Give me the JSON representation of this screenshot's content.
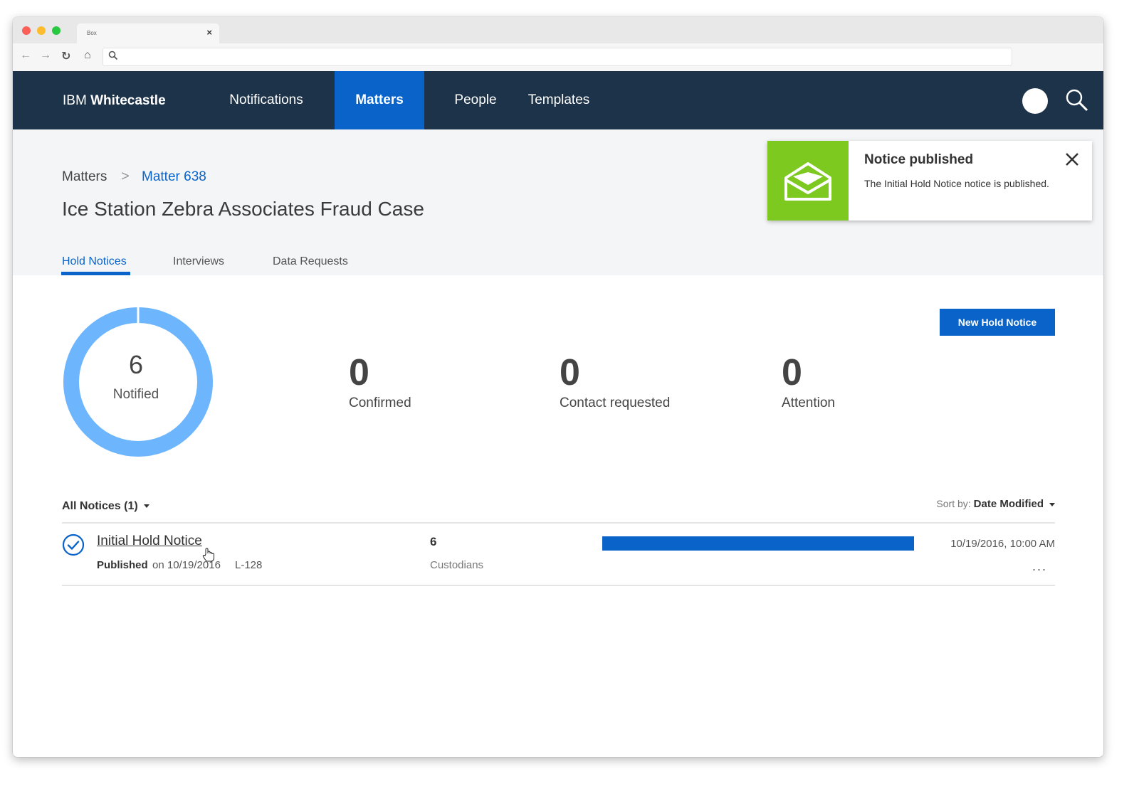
{
  "browser": {
    "tab_title": "Box",
    "tab_close": "×",
    "back": "←",
    "forward": "→",
    "reload": "↻",
    "home": "⌂",
    "address": ""
  },
  "app": {
    "brand_prefix": "IBM",
    "brand_name": "Whitecastle",
    "nav": {
      "notifications": "Notifications",
      "matters": "Matters",
      "people": "People",
      "templates": "Templates"
    },
    "active_nav": "Matters"
  },
  "breadcrumb": {
    "root": "Matters",
    "separator": ">",
    "current": "Matter 638"
  },
  "page_title": "Ice Station Zebra Associates Fraud Case",
  "tabs": {
    "hold_notices": "Hold Notices",
    "interviews": "Interviews",
    "data_requests": "Data Requests"
  },
  "active_tab": "Hold Notices",
  "toast": {
    "title": "Notice published",
    "message": "The Initial Hold Notice notice is published.",
    "icon": "envelope-open-icon",
    "color": "#7dc91f"
  },
  "stats": {
    "notified": {
      "value": "6",
      "label": "Notified"
    },
    "confirmed": {
      "value": "0",
      "label": "Confirmed"
    },
    "contact_requested": {
      "value": "0",
      "label": "Contact requested"
    },
    "attention": {
      "value": "0",
      "label": "Attention"
    }
  },
  "actions": {
    "new_hold_notice": "New Hold Notice"
  },
  "list": {
    "filter_label": "All Notices (1)",
    "sort_label": "Sort by:",
    "sort_value": "Date Modified",
    "items": [
      {
        "title": "Initial Hold Notice",
        "status": "Published",
        "published_on": "on 10/19/2016",
        "reference": "L-128",
        "custodians_count": "6",
        "custodians_label": "Custodians",
        "progress": 1.0,
        "modified": "10/19/2016, 10:00 AM",
        "more": "..."
      }
    ]
  },
  "colors": {
    "nav_bg": "#1d3349",
    "accent": "#0963c8",
    "donut": "#6db6fd",
    "success": "#7dc91f"
  }
}
